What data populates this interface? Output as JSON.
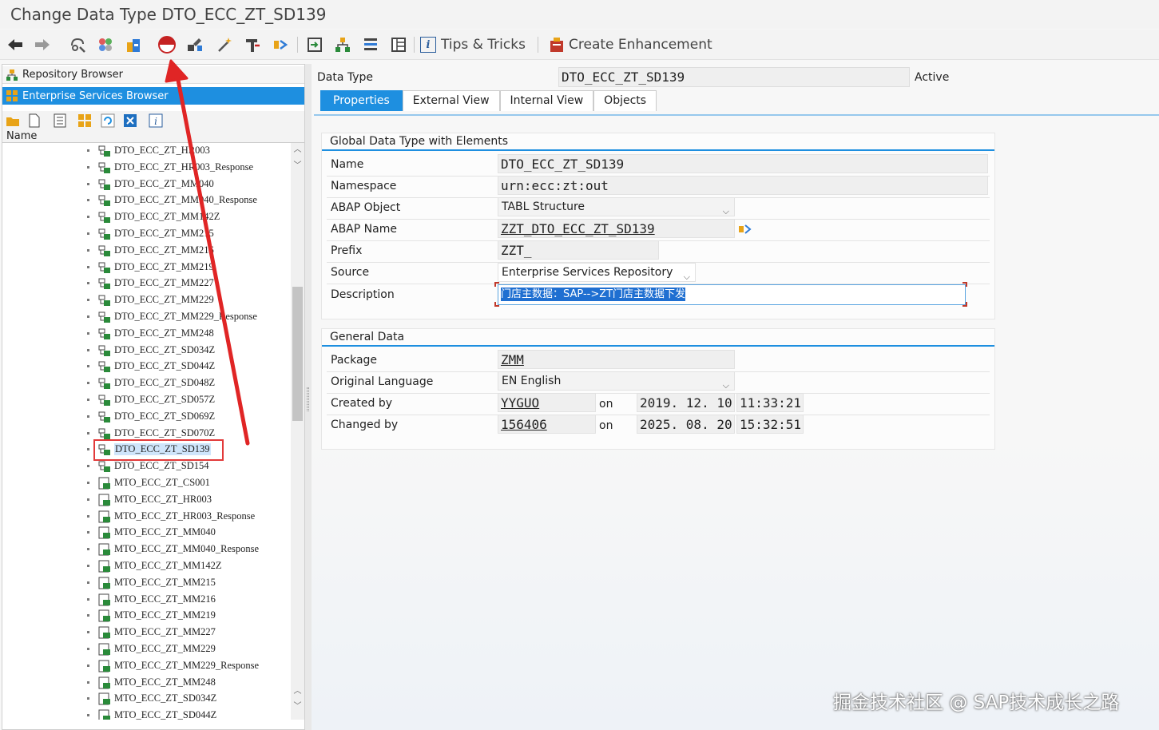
{
  "window": {
    "title": "Change Data Type DTO_ECC_ZT_SD139"
  },
  "toolbar": {
    "tips_label": "Tips & Tricks",
    "enhancement_label": "Create Enhancement",
    "icons": [
      "back-arrow-icon",
      "forward-arrow-icon",
      "display-change-icon",
      "other-object-icon",
      "transport-icon",
      "activate-icon",
      "test-icon",
      "wizard-icon",
      "where-used-icon",
      "navigate-icon",
      "window-icon",
      "hierarchy-icon",
      "stack-icon",
      "layout-icon",
      "info-icon",
      "enhancement-icon"
    ]
  },
  "left": {
    "repository_browser": "Repository Browser",
    "es_browser": "Enterprise Services Browser",
    "name_header": "Name",
    "items": [
      "DTO_ECC_ZT_HR003",
      "DTO_ECC_ZT_HR003_Response",
      "DTO_ECC_ZT_MM040",
      "DTO_ECC_ZT_MM040_Response",
      "DTO_ECC_ZT_MM142Z",
      "DTO_ECC_ZT_MM215",
      "DTO_ECC_ZT_MM216",
      "DTO_ECC_ZT_MM219",
      "DTO_ECC_ZT_MM227",
      "DTO_ECC_ZT_MM229",
      "DTO_ECC_ZT_MM229_Response",
      "DTO_ECC_ZT_MM248",
      "DTO_ECC_ZT_SD034Z",
      "DTO_ECC_ZT_SD044Z",
      "DTO_ECC_ZT_SD048Z",
      "DTO_ECC_ZT_SD057Z",
      "DTO_ECC_ZT_SD069Z",
      "DTO_ECC_ZT_SD070Z",
      "DTO_ECC_ZT_SD139",
      "DTO_ECC_ZT_SD154",
      "MTO_ECC_ZT_CS001",
      "MTO_ECC_ZT_HR003",
      "MTO_ECC_ZT_HR003_Response",
      "MTO_ECC_ZT_MM040",
      "MTO_ECC_ZT_MM040_Response",
      "MTO_ECC_ZT_MM142Z",
      "MTO_ECC_ZT_MM215",
      "MTO_ECC_ZT_MM216",
      "MTO_ECC_ZT_MM219",
      "MTO_ECC_ZT_MM227",
      "MTO_ECC_ZT_MM229",
      "MTO_ECC_ZT_MM229_Response",
      "MTO_ECC_ZT_MM248",
      "MTO_ECC_ZT_SD034Z",
      "MTO_ECC_ZT_SD044Z"
    ],
    "selected_index": 18
  },
  "header": {
    "type_label": "Data Type",
    "type_value": "DTO_ECC_ZT_SD139",
    "status": "Active"
  },
  "tabs": [
    "Properties",
    "External View",
    "Internal View",
    "Objects"
  ],
  "global_group": {
    "title": "Global Data Type with Elements",
    "name_label": "Name",
    "name_value": "DTO_ECC_ZT_SD139",
    "namespace_label": "Namespace",
    "namespace_value": "urn:ecc:zt:out",
    "abap_object_label": "ABAP Object",
    "abap_object_value": "TABL Structure",
    "abap_name_label": "ABAP Name",
    "abap_name_value": "ZZT_DTO_ECC_ZT_SD139",
    "prefix_label": "Prefix",
    "prefix_value": "ZZT_",
    "source_label": "Source",
    "source_value": "Enterprise Services Repository",
    "description_label": "Description",
    "description_value": "门店主数据：SAP-->ZT门店主数据下发"
  },
  "general_group": {
    "title": "General Data",
    "package_label": "Package",
    "package_value": "ZMM",
    "language_label": "Original Language",
    "language_value": "EN English",
    "created_label": "Created by",
    "created_user": "YYGUO",
    "created_on": "on",
    "created_date": "2019. 12. 10",
    "created_time": "11:33:21",
    "changed_label": "Changed by",
    "changed_user": "156406",
    "changed_on": "on",
    "changed_date": "2025. 08. 20",
    "changed_time": "15:32:51"
  },
  "watermark": "掘金技术社区 @ SAP技术成长之路",
  "colors": {
    "accent": "#1e8fe0",
    "annotation": "#e23a3a"
  }
}
